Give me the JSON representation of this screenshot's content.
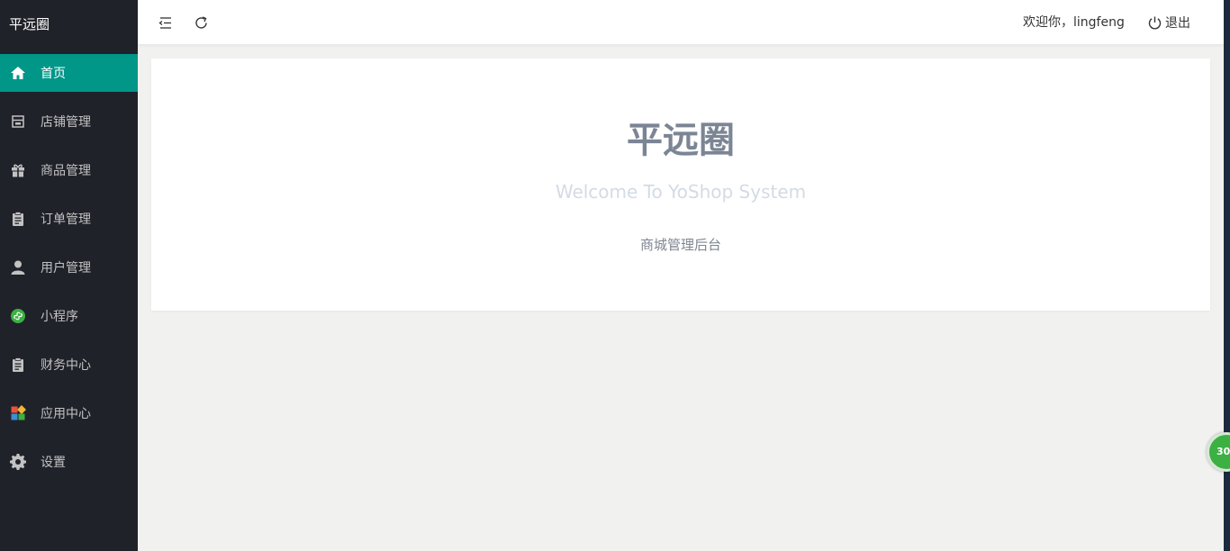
{
  "brand": "平远圈",
  "nav": [
    {
      "label": "首页",
      "icon": "home-icon",
      "active": true
    },
    {
      "label": "店铺管理",
      "icon": "store-icon"
    },
    {
      "label": "商品管理",
      "icon": "gift-icon"
    },
    {
      "label": "订单管理",
      "icon": "clipboard-icon"
    },
    {
      "label": "用户管理",
      "icon": "user-icon"
    },
    {
      "label": "小程序",
      "icon": "mini-program-icon"
    },
    {
      "label": "财务中心",
      "icon": "clipboard-icon"
    },
    {
      "label": "应用中心",
      "icon": "apps-icon"
    },
    {
      "label": "设置",
      "icon": "gear-icon"
    }
  ],
  "header": {
    "welcome": "欢迎你，lingfeng",
    "logout_label": "退出"
  },
  "main": {
    "title": "平远圈",
    "subtitle": "Welcome To YoShop System",
    "description": "商城管理后台"
  },
  "badge": {
    "text": "30"
  },
  "colors": {
    "sidebar_bg": "#20222a",
    "active_bg": "#009688",
    "content_bg": "#f1f1f0",
    "mini_program_green": "#3cb043"
  }
}
